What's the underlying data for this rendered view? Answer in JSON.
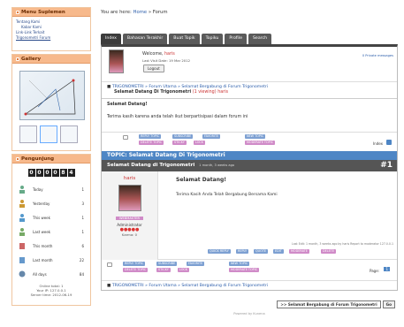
{
  "sidebar": {
    "menu_title": "Menu Suplemen",
    "menu_items": [
      "Tentang Kami",
      "Kabar Kami",
      "Link-Link Terkait",
      "Trigonometri Forum"
    ],
    "gallery_title": "Gallery",
    "stats_title": "Pengunjung",
    "counter": [
      "0",
      "0",
      "0",
      "0",
      "8",
      "4"
    ],
    "stats": [
      {
        "label": "Today",
        "value": "1"
      },
      {
        "label": "Yesterday",
        "value": "3"
      },
      {
        "label": "This week",
        "value": "1"
      },
      {
        "label": "Last week",
        "value": "1"
      },
      {
        "label": "This month",
        "value": "6"
      },
      {
        "label": "Last month",
        "value": "22"
      },
      {
        "label": "All days",
        "value": "84"
      }
    ],
    "online": [
      "Online total: 1",
      "Your IP: 127.0.0.1",
      "Server time: 2012-06-19"
    ]
  },
  "header": {
    "you_are_here": "You are here:",
    "crumb_home": "Home",
    "crumb_forum": "Forum"
  },
  "tabs": [
    "Index",
    "Bahasan Terakhir",
    "Buat Topik",
    "Topiku",
    "Profile",
    "Search"
  ],
  "welcome": {
    "text": "Welcome,",
    "user": "haris",
    "last_visit": "Last Visit Date: 19 Mar 2012",
    "logout": "Logout",
    "pm": "0 Private messages"
  },
  "breadcrumb": "TRIGONOMETRI » Forum Utama » Selamat Bergabung di Forum Trigonometri",
  "viewing": {
    "text": "Selamat Datang Di Trigonometri",
    "count": "(1 viewing)",
    "user": "haris"
  },
  "preview": {
    "title": "Selamat Datang!",
    "body": "Terima kasih karena anda telah ikut berpartisipasi dalam forum ini"
  },
  "action_buttons": [
    "REPLY TOPIC",
    "SUBSCRIBE",
    "FAVORITE",
    "NEW TOPIC",
    "DELETE TOPIC",
    "STICKY",
    "LOCK",
    "MODERATE TOPIC"
  ],
  "index_label": "Index",
  "topic_bar": "TOPIC: Selamat Datang Di Trigonometri",
  "post": {
    "header": "Selamat Datang di Trigonometri",
    "meta": "1 month, 3 weeks ago",
    "number": "#1",
    "author": "haris",
    "role": "Administrator",
    "rank_badge": "WEBMASTER",
    "stars": "●●●●●",
    "karma": "Karma: 0",
    "title": "Selamat Datang!",
    "body": "Terima Kasih Anda Telah Bergabung Bersama Kami",
    "footer": "Last Edit: 1 month, 3 weeks ago by haris     Report to moderator     127.0.0.1",
    "buttons": [
      "QUICK REPLY",
      "REPLY",
      "QUOTE",
      "EDIT",
      "MODERATE",
      "DELETE"
    ]
  },
  "page_label": "Page:",
  "page_num": "1",
  "breadcrumb2": "TRIGONOMETRI » Forum Utama » Selamat Bergabung di Forum Trigonometri",
  "jump": {
    "select": ">> Selamat Bergabung di Forum Trigonometri",
    "go": "Go"
  },
  "powered": "Powered by Kunena"
}
